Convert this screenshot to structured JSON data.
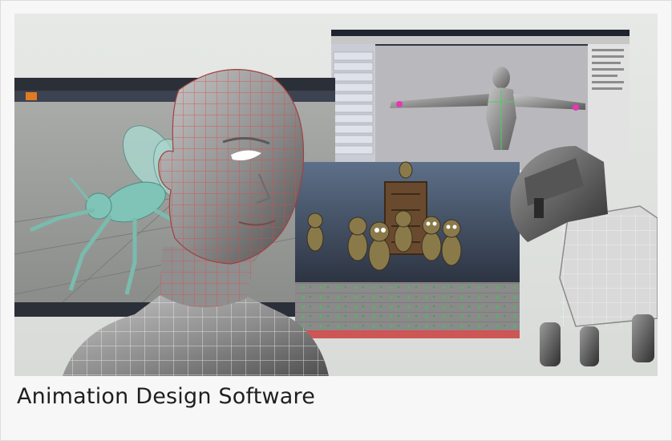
{
  "caption": "Animation Design Software",
  "image_alt": "Collage of 3D animation software: wireframe head, insect model, character rig, cartoon figures and robot dog"
}
